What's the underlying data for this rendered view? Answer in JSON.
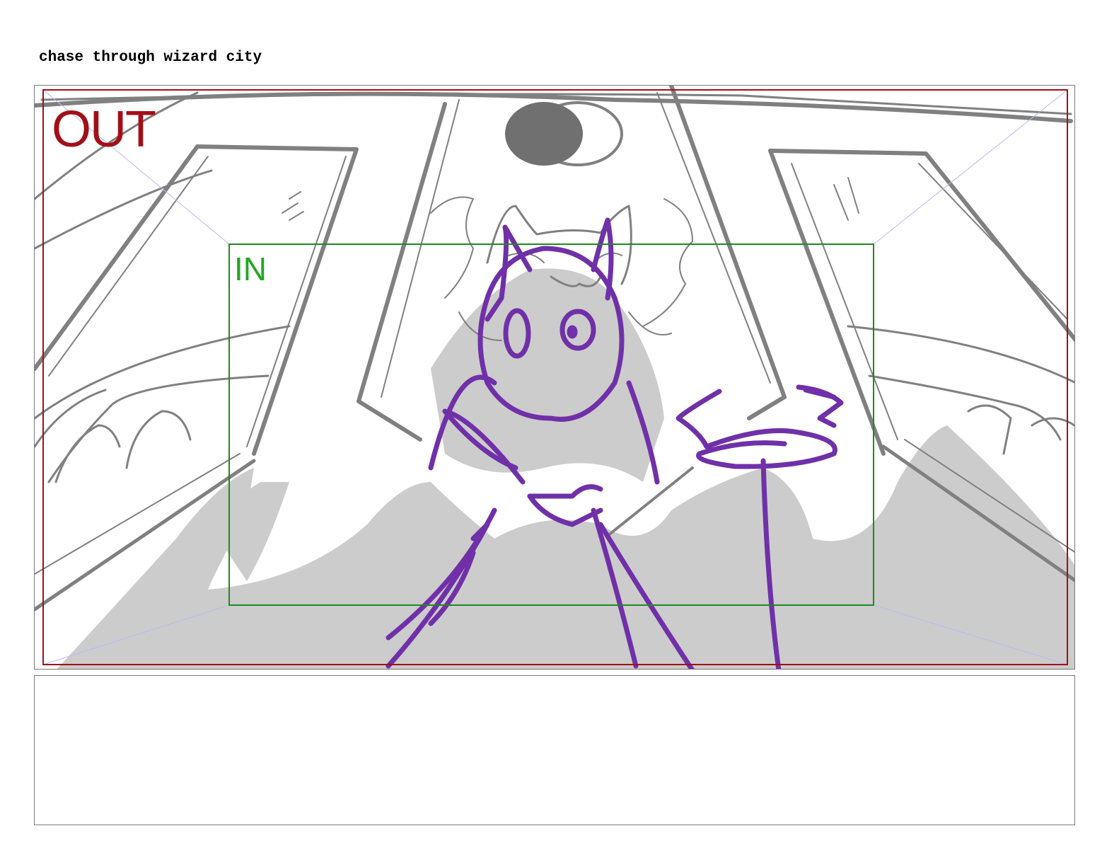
{
  "scene": {
    "title": "chase through wizard city"
  },
  "panel": {
    "out_label": "OUT",
    "in_label": "IN"
  },
  "colors": {
    "out_frame": "#a30f17",
    "in_frame": "#1f8a1f",
    "in_label": "#22a722",
    "sketch_gray": "#808080",
    "shadow_gray": "#cccccc",
    "character_purple": "#7030a8",
    "guide_lines": "#b9b9f0"
  },
  "icons": {
    "character": "wizard-character-sketch",
    "staff": "wizard-staff-sketch",
    "cat": "cat-creature-sketch"
  },
  "notes": {
    "text": ""
  }
}
